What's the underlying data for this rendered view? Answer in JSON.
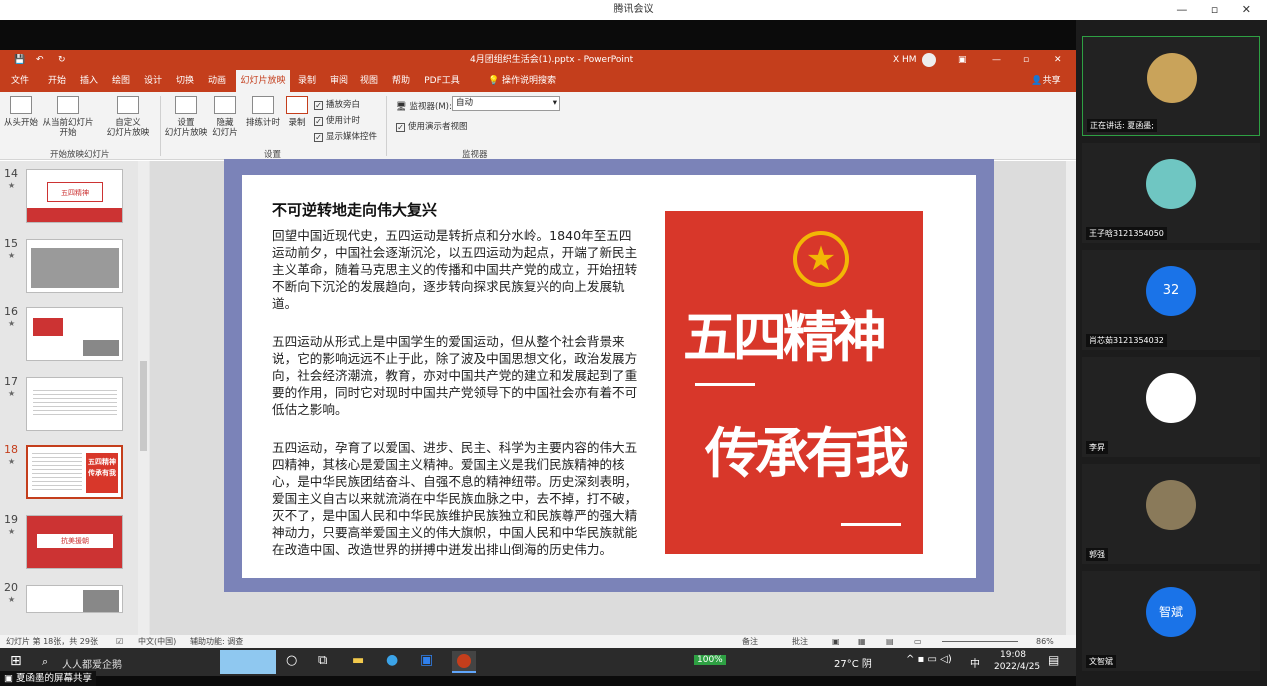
{
  "window": {
    "title": "腾讯会议",
    "controls": "— ▫ ✕"
  },
  "ppt": {
    "title": "4月团组织生活会(1).pptx  -  PowerPoint",
    "user": "X HM",
    "tabs": [
      "文件",
      "开始",
      "插入",
      "绘图",
      "设计",
      "切换",
      "动画",
      "幻灯片放映",
      "录制",
      "审阅",
      "视图",
      "帮助",
      "PDF工具",
      "操作说明搜索"
    ],
    "share": "共享",
    "ribbon": {
      "from_start": "从头开始",
      "from_current_1": "从当前幻灯片",
      "from_current_2": "开始",
      "custom_1": "自定义",
      "custom_2": "幻灯片放映",
      "setup_1": "设置",
      "setup_2": "幻灯片放映",
      "hide_1": "隐藏",
      "hide_2": "幻灯片",
      "rehearse": "排练计时",
      "record": "录制",
      "chk_narration": "播放旁白",
      "chk_timing": "使用计时",
      "chk_media": "显示媒体控件",
      "monitor_label": "监视器(M):",
      "monitor_value": "自动",
      "presenter_view": "使用演示者视图",
      "group_start": "开始放映幻灯片",
      "group_setup": "设置",
      "group_monitor": "监视器"
    },
    "thumbs": [
      {
        "num": "14",
        "title": "五四精神"
      },
      {
        "num": "15",
        "title": ""
      },
      {
        "num": "16",
        "title": ""
      },
      {
        "num": "17",
        "title": ""
      },
      {
        "num": "18",
        "title": "五四精神 传承有我"
      },
      {
        "num": "19",
        "title": "抗美援朝"
      },
      {
        "num": "20",
        "title": ""
      }
    ],
    "slide": {
      "heading": "不可逆转地走向伟大复兴",
      "p1": "回望中国近现代史，五四运动是转折点和分水岭。1840年至五四运动前夕，中国社会逐渐沉沦，以五四运动为起点，开端了新民主主义革命，随着马克思主义的传播和中国共产党的成立，开始扭转不断向下沉沦的发展趋向，逐步转向探求民族复兴的向上发展轨道。",
      "p2": "五四运动从形式上是中国学生的爱国运动，但从整个社会背景来说，它的影响远远不止于此，除了波及中国思想文化，政治发展方向，社会经济潮流，教育，亦对中国共产党的建立和发展起到了重要的作用，同时它对现时中国共产党领导下的中国社会亦有着不可低估之影响。",
      "p3": "五四运动，孕育了以爱国、进步、民主、科学为主要内容的伟大五四精神，其核心是爱国主义精神。爱国主义是我们民族精神的核心，是中华民族团结奋斗、自强不息的精神纽带。历史深刻表明，爱国主义自古以来就流淌在中华民族血脉之中，去不掉，打不破，灭不了，是中国人民和中华民族维护民族独立和民族尊严的强大精神动力，只要高举爱国主义的伟大旗帜，中国人民和中华民族就能在改造中国、改造世界的拼搏中迸发出排山倒海的历史伟力。",
      "poster_1": "五四精神",
      "poster_2": "传承有我"
    },
    "status": {
      "slide": "幻灯片 第 18张，共 29张",
      "lang": "中文(中国)",
      "access": "辅助功能: 调查",
      "notes": "备注",
      "comments": "批注",
      "zoom": "86%"
    }
  },
  "taskbar": {
    "search": "人人都爱企鹅",
    "battery": "100%",
    "weather": "27°C 阴",
    "time": "19:08",
    "date": "2022/4/25",
    "ime": "中"
  },
  "share_label": "夏函墨的屏幕共享",
  "participants": [
    {
      "name": "正在讲话: 夏函墨;",
      "avatar": "",
      "color": "#c9a35a"
    },
    {
      "name": "王子晗3121354050",
      "avatar": "",
      "color": "#6fc6c2"
    },
    {
      "name": "肖芯茹3121354032",
      "avatar": "32",
      "color": "#1a73e8"
    },
    {
      "name": "李昇",
      "avatar": "",
      "color": "#ffffff"
    },
    {
      "name": "郭强",
      "avatar": "",
      "color": "#8a7a5a"
    },
    {
      "name": "文智斌",
      "avatar": "智斌",
      "color": "#1a73e8"
    }
  ]
}
